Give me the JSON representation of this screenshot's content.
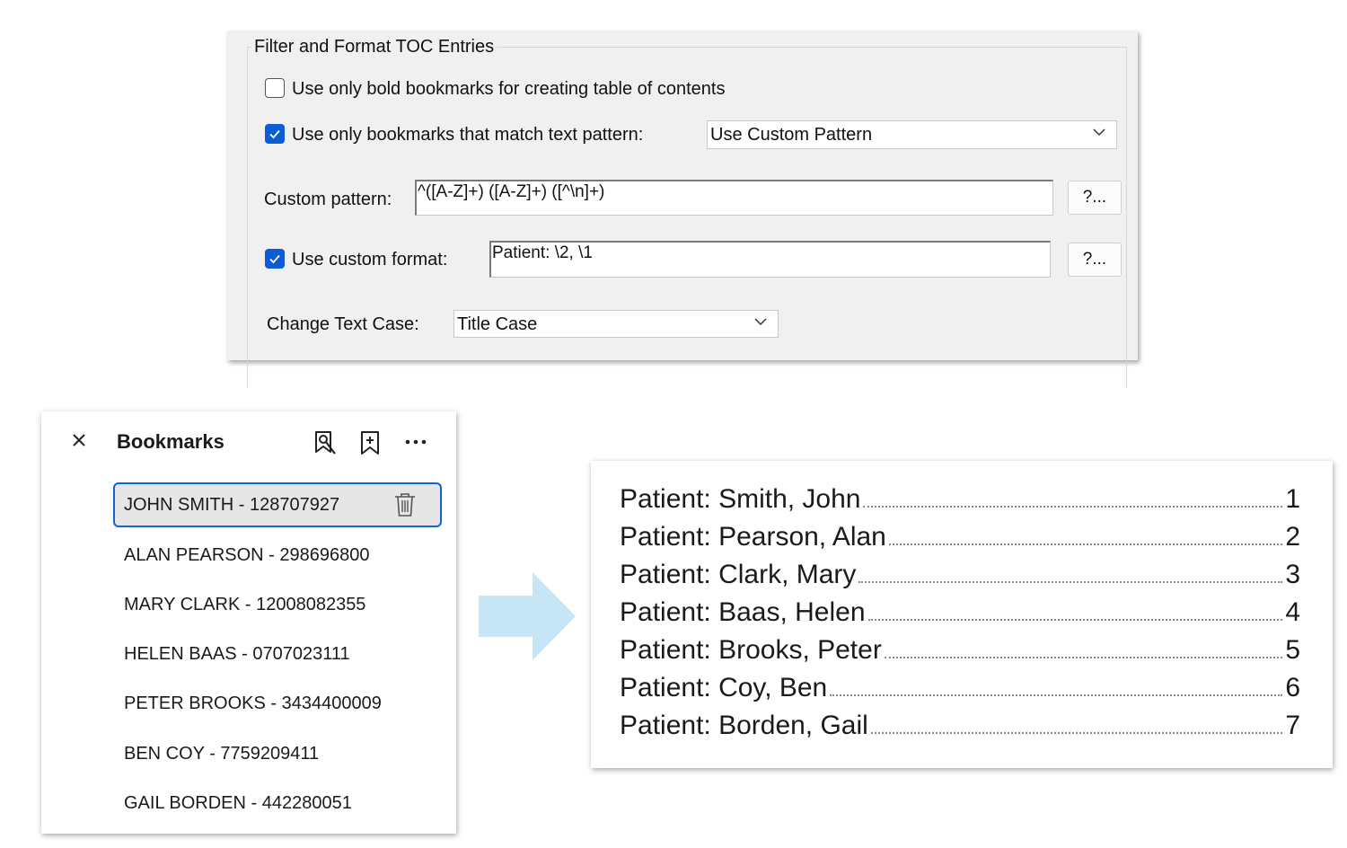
{
  "dialog": {
    "group_title": "Filter and Format TOC Entries",
    "bold_only": {
      "label": "Use only bold bookmarks for creating table of contents",
      "checked": false
    },
    "match_pattern": {
      "label": "Use only bookmarks that match text pattern:",
      "checked": true,
      "selected": "Use Custom Pattern"
    },
    "custom_pattern": {
      "label": "Custom pattern:",
      "value": "^([A-Z]+) ([A-Z]+) ([^\\n]+)",
      "help_label": "?..."
    },
    "custom_format": {
      "label": "Use custom format:",
      "checked": true,
      "value": "Patient: \\2, \\1",
      "help_label": "?..."
    },
    "text_case": {
      "label": "Change Text Case:",
      "selected": "Title Case"
    },
    "accent_color": "#0b5cd5"
  },
  "bookmarks": {
    "title": "Bookmarks",
    "items": [
      {
        "label": "JOHN SMITH - 128707927"
      },
      {
        "label": "ALAN PEARSON - 298696800"
      },
      {
        "label": "MARY CLARK - 12008082355"
      },
      {
        "label": "HELEN BAAS - 0707023111"
      },
      {
        "label": "PETER BROOKS - 3434400009"
      },
      {
        "label": "BEN COY - 7759209411"
      },
      {
        "label": "GAIL BORDEN - 442280051"
      }
    ],
    "selected_index": 0
  },
  "arrow_color": "#c6e6f6",
  "toc": {
    "entries": [
      {
        "text": "Patient: Smith, John",
        "page": "1"
      },
      {
        "text": "Patient: Pearson, Alan",
        "page": "2"
      },
      {
        "text": "Patient: Clark, Mary",
        "page": "3"
      },
      {
        "text": "Patient: Baas, Helen",
        "page": "4"
      },
      {
        "text": "Patient: Brooks, Peter",
        "page": "5"
      },
      {
        "text": "Patient: Coy, Ben",
        "page": "6"
      },
      {
        "text": "Patient: Borden, Gail",
        "page": "7"
      }
    ]
  }
}
